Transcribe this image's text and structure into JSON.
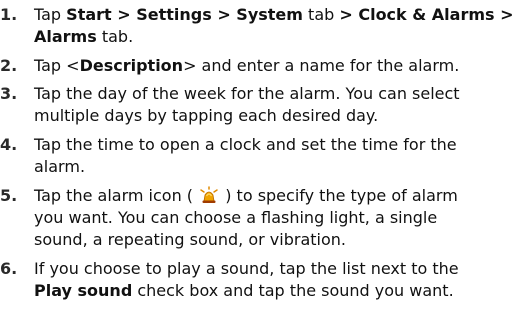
{
  "steps": [
    {
      "num": "1.",
      "l1": {
        "a": "Tap ",
        "b": "Start > Settings > System",
        "c": " tab ",
        "d": "> Clock & Alarms >"
      },
      "l2": {
        "b": "Alarms",
        "c": " tab."
      }
    },
    {
      "num": "2.",
      "l1": {
        "a": "Tap <",
        "b": "Description",
        "c": "> and enter a name for the alarm."
      }
    },
    {
      "num": "3.",
      "l1": "Tap the day of the week for the alarm. You can select",
      "l2": "multiple days by tapping each desired day."
    },
    {
      "num": "4.",
      "l1": "Tap the time to open a clock and set the time for the",
      "l2": "alarm."
    },
    {
      "num": "5.",
      "l1": {
        "a": "Tap the alarm icon ( ",
        "icon": "alarm-bell-icon",
        "c": " ) to specify the type of alarm"
      },
      "l2": "you want. You can choose a flashing light, a single",
      "l3": "sound, a repeating sound, or vibration."
    },
    {
      "num": "6.",
      "l1": "If you choose to play a sound, tap the list next to the",
      "l2": {
        "b": "Play sound",
        "c": " check box and tap the sound you want."
      }
    }
  ]
}
